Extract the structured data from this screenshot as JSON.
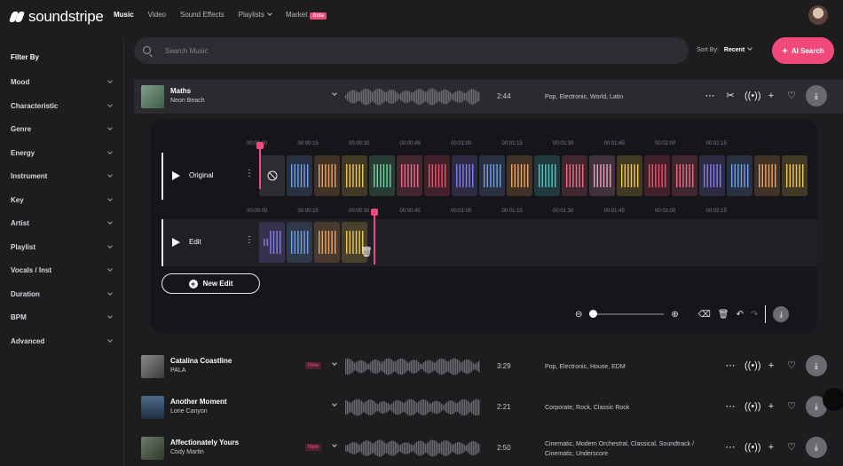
{
  "brand": "soundstripe",
  "nav": {
    "music": "Music",
    "video": "Video",
    "sound_effects": "Sound Effects",
    "playlists": "Playlists",
    "market": "Market",
    "beta": "Beta"
  },
  "sidebar": {
    "title": "Filter By",
    "items": [
      "Mood",
      "Characteristic",
      "Genre",
      "Energy",
      "Instrument",
      "Key",
      "Artist",
      "Playlist",
      "Vocals / Inst",
      "Duration",
      "BPM",
      "Advanced"
    ]
  },
  "search": {
    "placeholder": "Search Music"
  },
  "sort": {
    "label": "Sort By:",
    "value": "Recent"
  },
  "ai_search": "AI Search",
  "tracks": [
    {
      "title": "Maths",
      "artist": "Neon Beach",
      "duration": "2:44",
      "tags": "Pop, Electronic, World, Latin",
      "new": ""
    },
    {
      "title": "Catalina Coastline",
      "artist": "PALA",
      "duration": "3:29",
      "tags": "Pop, Electronic, House, EDM",
      "new": "New"
    },
    {
      "title": "Another Moment",
      "artist": "Lone Canyon",
      "duration": "2:21",
      "tags": "Corporate, Rock, Classic Rock",
      "new": ""
    },
    {
      "title": "Affectionately Yours",
      "artist": "Cody Martin",
      "duration": "2:50",
      "tags": "Cinematic, Modern Orchestral, Classical, Soundtrack / Cinematic, Underscore",
      "new": "New"
    }
  ],
  "editor": {
    "ruler_labels": [
      "00:00:00",
      "00:00:15",
      "00:00:30",
      "00:00:45",
      "00:01:00",
      "00:01:15",
      "00:01:30",
      "00:01:45",
      "00:02:00",
      "00:02:15"
    ],
    "original_label": "Original",
    "edit_label": "Edit",
    "new_edit": "New Edit",
    "original_playhead_fraction": 0.0,
    "edit_playhead_time": "00:00:34",
    "zoom_level": 0.0
  },
  "colors": {
    "accent": "#f2497d",
    "bg": "#1d1d20",
    "panel": "#16161a"
  },
  "icons": [
    "search-icon",
    "sparkle-icon",
    "more-icon",
    "scissors-icon",
    "broadcast-icon",
    "plus-icon",
    "heart-icon",
    "download-icon",
    "zoom-out-icon",
    "zoom-in-icon",
    "clear-icon",
    "trash-icon",
    "undo-icon",
    "redo-icon",
    "no-entry-icon"
  ]
}
